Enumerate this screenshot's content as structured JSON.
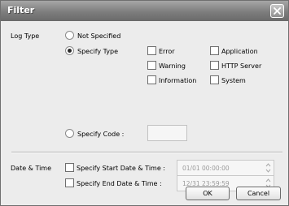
{
  "window": {
    "title": "Filter",
    "close_icon": "close-x-icon"
  },
  "log_type": {
    "label": "Log Type",
    "not_specified": {
      "label": "Not Specified",
      "selected": false
    },
    "specify_type": {
      "label": "Specify Type",
      "selected": true
    },
    "types": [
      {
        "label": "Error",
        "checked": false
      },
      {
        "label": "Application",
        "checked": false
      },
      {
        "label": "Warning",
        "checked": false
      },
      {
        "label": "HTTP Server",
        "checked": false
      },
      {
        "label": "Information",
        "checked": false
      },
      {
        "label": "System",
        "checked": false
      }
    ],
    "specify_code": {
      "label": "Specify Code :",
      "selected": false,
      "value": ""
    }
  },
  "date_time": {
    "label": "Date & Time",
    "start": {
      "label": "Specify Start Date & Time :",
      "checked": false,
      "value": "01/01 00:00:00"
    },
    "end": {
      "label": "Specify End Date & Time :",
      "checked": false,
      "value": "12/31 23:59:59"
    }
  },
  "buttons": {
    "ok": "OK",
    "cancel": "Cancel"
  }
}
